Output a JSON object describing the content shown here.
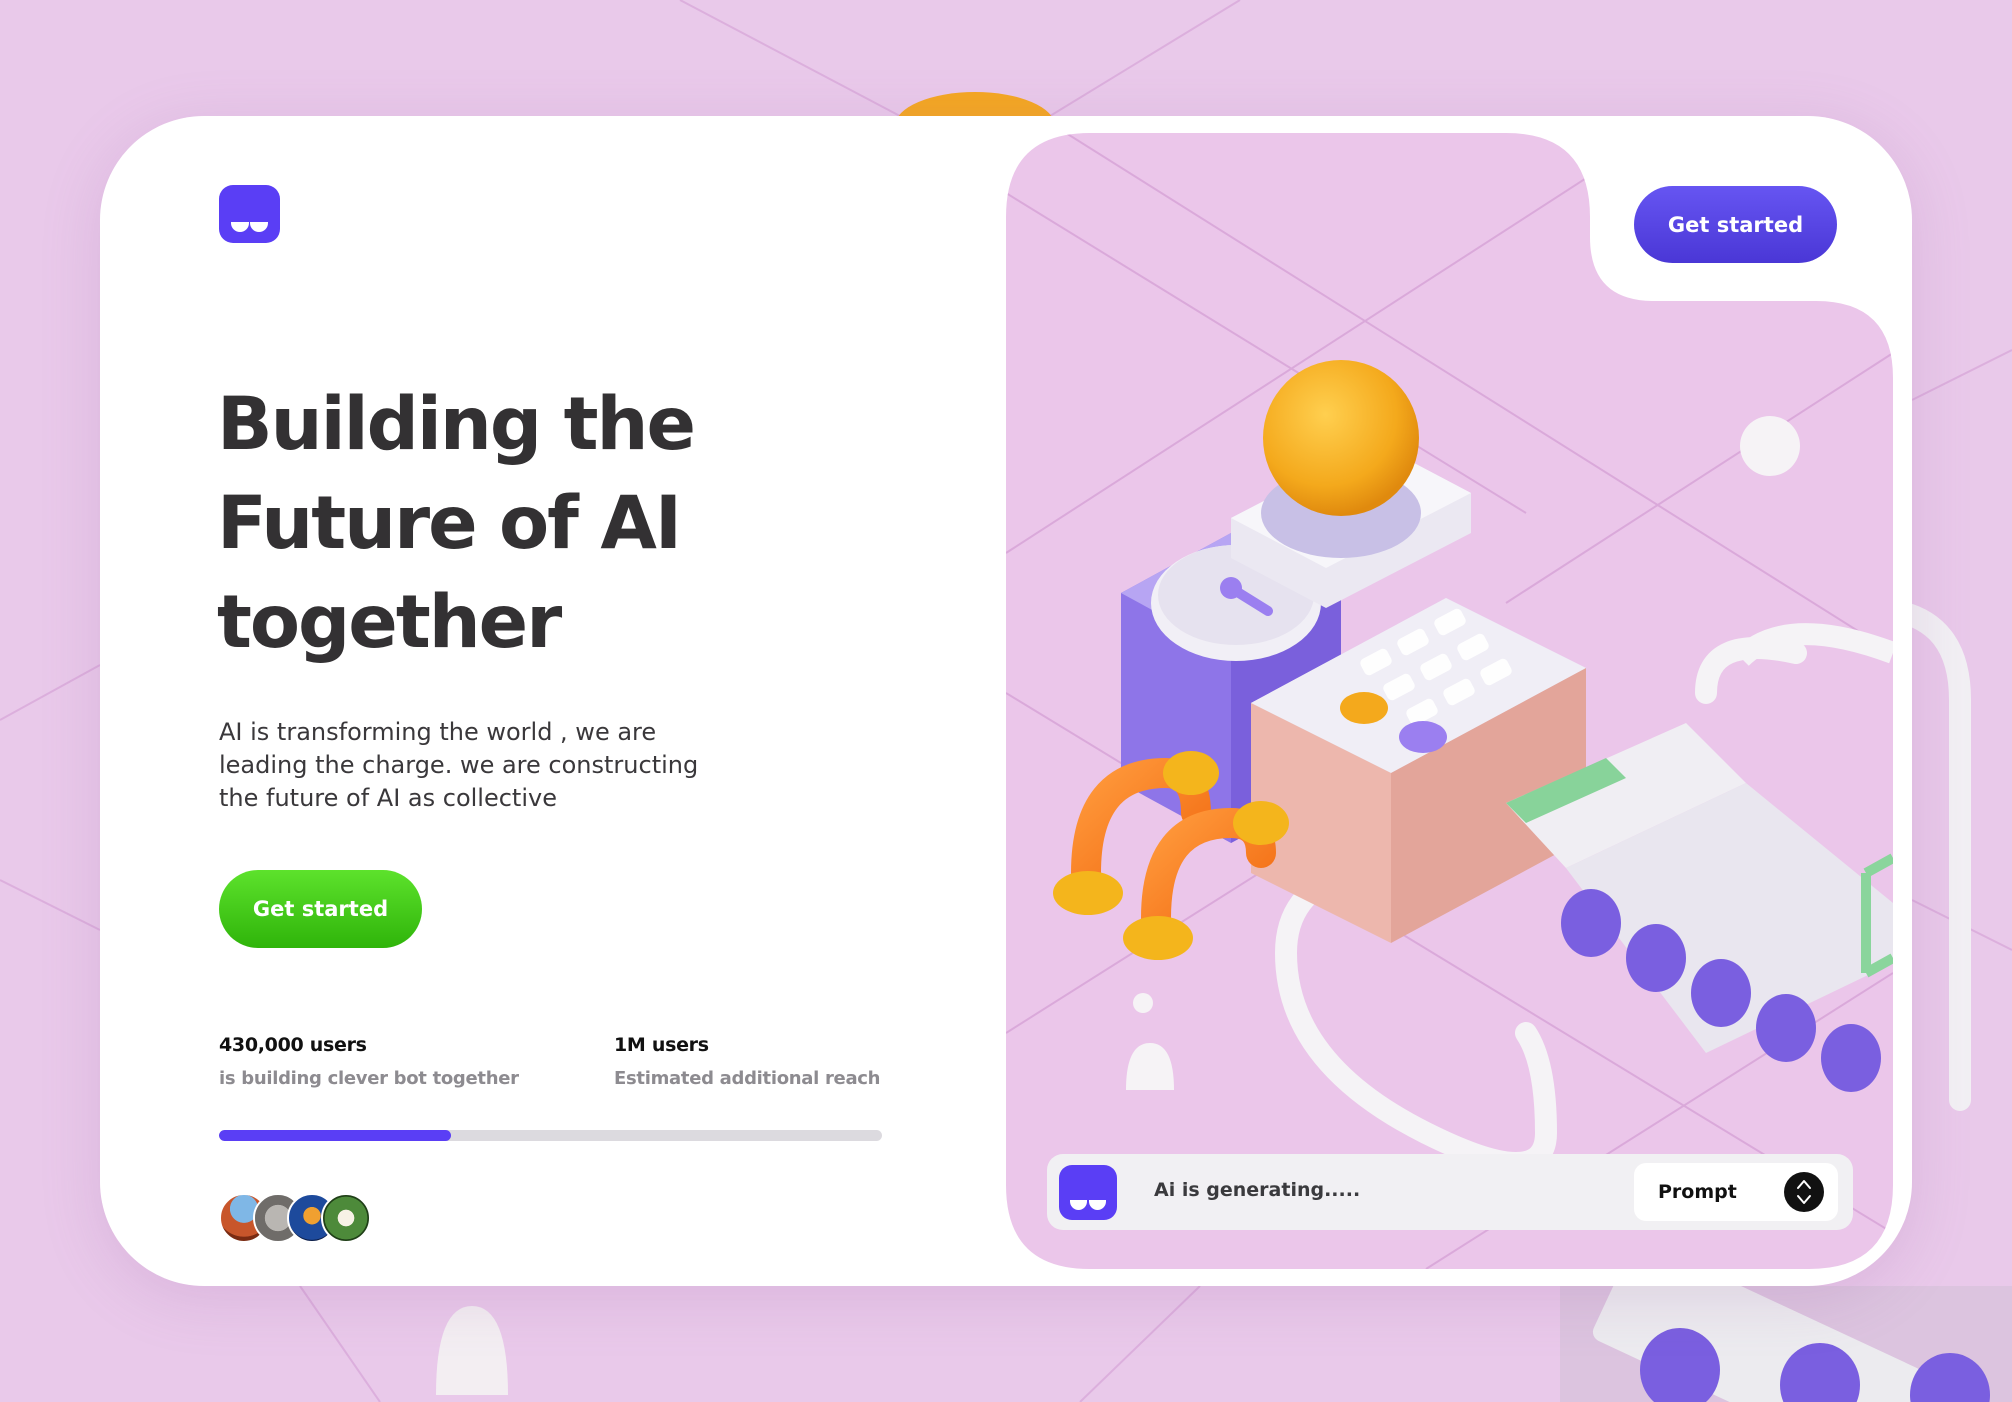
{
  "brand": {
    "logo_icon": "bot-face-icon",
    "accent_color": "#5a3ef5",
    "cta_green": "#3fc614"
  },
  "hero": {
    "headline_line1": "Building the",
    "headline_line2": "Future of AI",
    "headline_line3": "together",
    "subtext_line1": "AI is transforming the world , we are",
    "subtext_line2": "leading the charge. we are constructing",
    "subtext_line3": "the future of AI as collective",
    "cta_label": "Get started"
  },
  "stats": [
    {
      "value": "430,000 users",
      "description": "is building  clever bot together"
    },
    {
      "value": "1M users",
      "description": "Estimated additional reach"
    }
  ],
  "progress": {
    "fraction": 0.35
  },
  "avatars": [
    "canyon-avatar",
    "koala-avatar",
    "jellyfish-avatar",
    "flower-avatar"
  ],
  "header": {
    "cta_label": "Get started"
  },
  "prompt_bar": {
    "status_text": "Ai is generating.....",
    "button_label": "Prompt",
    "button_icon": "up-down-chevron-icon"
  }
}
